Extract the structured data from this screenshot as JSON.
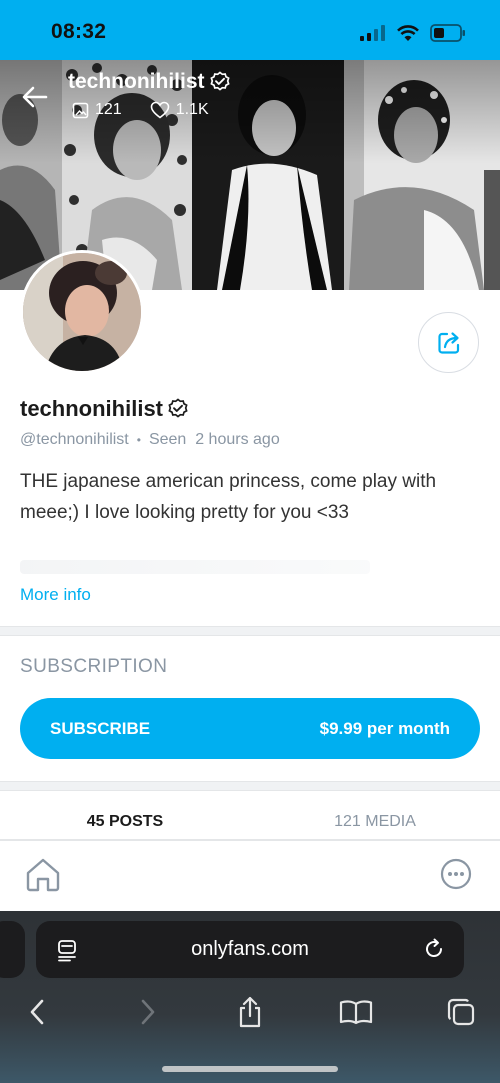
{
  "status_bar": {
    "time": "08:32"
  },
  "cover": {
    "username": "technonihilist",
    "media_count": "121",
    "likes_count": "1.1K"
  },
  "profile": {
    "name": "technonihilist",
    "handle": "@technonihilist",
    "separator": "•",
    "seen": "Seen  2 hours ago",
    "bio": "THE japanese american princess, come play with meee;) I love looking pretty for you <33",
    "more_info": "More info"
  },
  "subscription": {
    "label": "SUBSCRIPTION",
    "button_label": "SUBSCRIBE",
    "price": "$9.99 per month"
  },
  "tabs": [
    {
      "label": "45 POSTS",
      "active": true
    },
    {
      "label": "121 MEDIA",
      "active": false
    }
  ],
  "browser": {
    "url": "onlyfans.com"
  },
  "colors": {
    "accent": "#00aff0",
    "muted": "#8a96a3",
    "text": "#1b1b1b"
  }
}
